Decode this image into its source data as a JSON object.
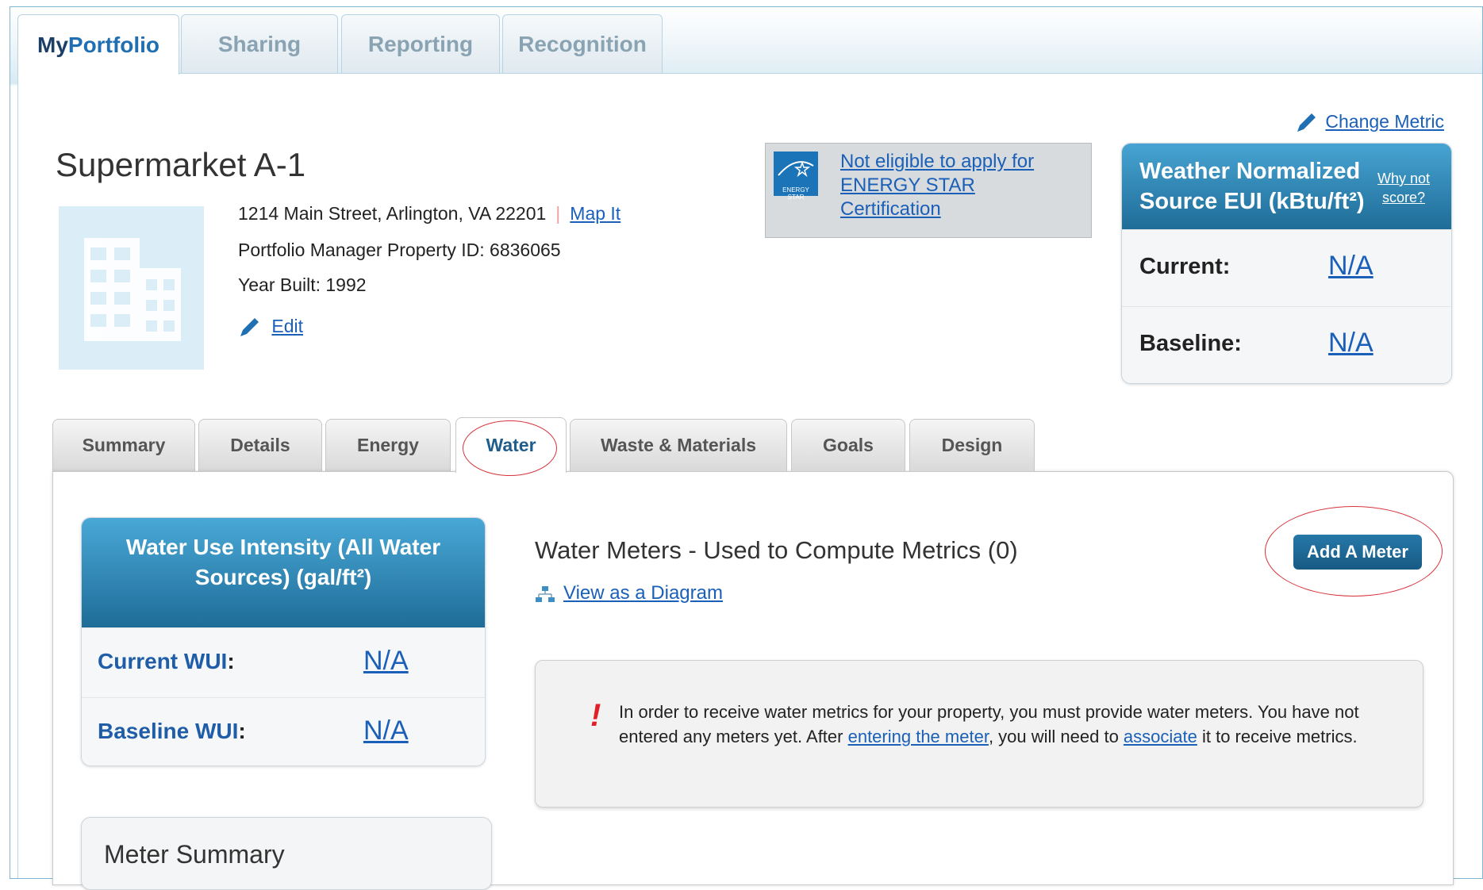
{
  "top_tabs": [
    {
      "label_prefix": "My",
      "label": "Portfolio"
    },
    {
      "label": "Sharing"
    },
    {
      "label": "Reporting"
    },
    {
      "label": "Recognition"
    }
  ],
  "property": {
    "name": "Supermarket A-1",
    "address": "1214 Main Street, Arlington, VA 22201",
    "map_link": "Map It",
    "pm_id": "Portfolio Manager Property ID: 6836065",
    "year_built": "Year Built: 1992",
    "edit_link": "Edit"
  },
  "energy_star": {
    "logo_text": "ENERGY STAR",
    "message": "Not eligible to apply for ENERGY STAR Certification"
  },
  "metric_card": {
    "change_metric": "Change Metric",
    "title_line1": "Weather Normalized",
    "title_line2": "Source EUI (kBtu/ft²)",
    "why_line1": "Why not",
    "why_line2": "score?",
    "current_label": "Current:",
    "current_value": "N/A",
    "baseline_label": "Baseline:",
    "baseline_value": "N/A"
  },
  "property_tabs": [
    "Summary",
    "Details",
    "Energy",
    "Water",
    "Waste & Materials",
    "Goals",
    "Design"
  ],
  "active_tab": "Water",
  "wui_card": {
    "title_line1": "Water Use Intensity (All Water",
    "title_line2": "Sources) (gal/ft²)",
    "current_label": "Current WUI",
    "current_value": "N/A",
    "baseline_label": "Baseline WUI",
    "baseline_value": "N/A",
    "colon": ":"
  },
  "meter_summary": "Meter Summary",
  "water_meters": {
    "title": "Water Meters - Used to Compute Metrics (0)",
    "diagram_link": "View as a Diagram",
    "add_button": "Add A Meter"
  },
  "alert": {
    "icon": "!",
    "text_before": "In order to receive water metrics for your property, you must provide water meters. You have not entered any meters yet. After ",
    "link1": "entering the meter",
    "text_middle": ", you will need to ",
    "link2": "associate",
    "text_after": " it to receive metrics."
  },
  "colors": {
    "accent_blue": "#1f6c98",
    "link_blue": "#1a5fb8",
    "alert_red": "#e01f26",
    "highlight_ellipse": "#d8333b"
  }
}
